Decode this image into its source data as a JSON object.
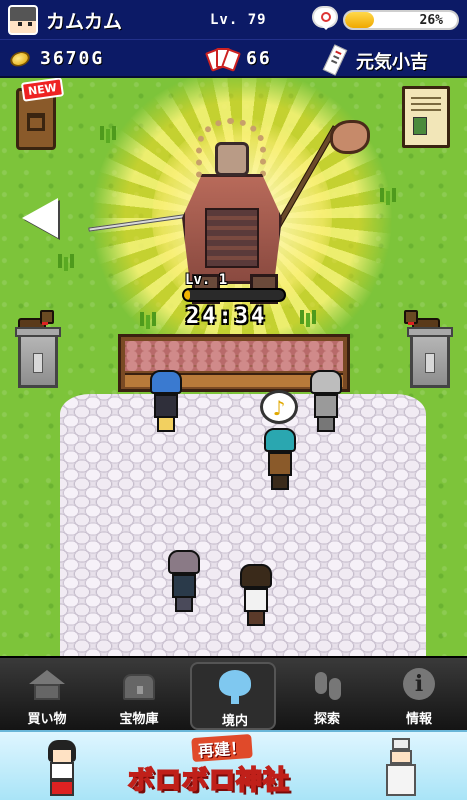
{
  "hud": {
    "player_name": "カムカム",
    "level": "Lv. 79",
    "mood_percent": "26%",
    "mood_fill": 0.26,
    "gold": "3670G",
    "cards": "66",
    "fortune": "元気小吉"
  },
  "game": {
    "mailbox_badge": "NEW",
    "boss_level": "Lv. 1",
    "boss_progress": 0.06,
    "timer": "24:34",
    "speech_note": "♪"
  },
  "nav": {
    "items": [
      {
        "label": "買い物",
        "icon": "shop-icon",
        "active": false
      },
      {
        "label": "宝物庫",
        "icon": "chest-icon",
        "active": false
      },
      {
        "label": "境内",
        "icon": "tree-icon",
        "active": true
      },
      {
        "label": "探索",
        "icon": "footprints-icon",
        "active": false
      },
      {
        "label": "情報",
        "icon": "info-icon",
        "active": false
      }
    ]
  },
  "banner": {
    "subtitle": "再建！",
    "title": "ボロボロ神社"
  },
  "colors": {
    "hud_bg": "#0c1a66",
    "grass": "#7dc43a",
    "aura": "#ffe85a",
    "nav_active_icon": "#7fc8f0",
    "banner_title": "#c0201a"
  }
}
